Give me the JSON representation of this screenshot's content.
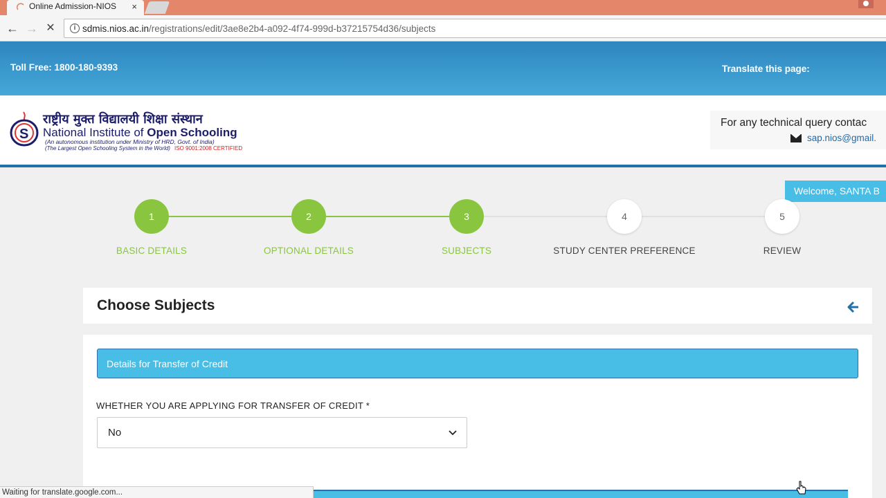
{
  "browser": {
    "tab_title": "Online Admission-NIOS",
    "tab_close": "×",
    "url_host": "sdmis.nios.ac.in",
    "url_path": "/registrations/edit/3ae8e2b4-a092-4f74-999d-b37215754d36/subjects",
    "status_text": "Waiting for translate.google.com..."
  },
  "header": {
    "toll_free": "Toll Free: 1800-180-9393",
    "translate_label": "Translate this page:"
  },
  "logo": {
    "hindi_name": "राष्ट्रीय मुक्त विद्यालयी शिक्षा संस्थान",
    "name_part1": "National Institute of ",
    "name_part2": "Open Schooling",
    "sub1": "(An autonomous institution under  Ministry of HRD, Govt. of India)",
    "sub2": "(The Largest Open Schooling System in the World)",
    "iso": "ISO 9001:2008 CERTIFIED"
  },
  "contact": {
    "query_text": "For any technical query contac",
    "email": "sap.nios@gmail."
  },
  "welcome": "Welcome, SANTA B",
  "steps": [
    {
      "number": "1",
      "label": "BASIC DETAILS",
      "status": "done"
    },
    {
      "number": "2",
      "label": "OPTIONAL DETAILS",
      "status": "done"
    },
    {
      "number": "3",
      "label": "SUBJECTS",
      "status": "done"
    },
    {
      "number": "4",
      "label": "STUDY CENTER PREFERENCE",
      "status": "todo"
    },
    {
      "number": "5",
      "label": "REVIEW",
      "status": "todo"
    }
  ],
  "card": {
    "title": "Choose Subjects",
    "section_title": "Details for Transfer of Credit",
    "field_label": "WHETHER YOU ARE APPLYING FOR TRANSFER OF CREDIT *",
    "field_value": "No"
  },
  "colors": {
    "accent_blue": "#48bde6",
    "step_done": "#8ac540",
    "tab_strip": "#e3866a"
  }
}
